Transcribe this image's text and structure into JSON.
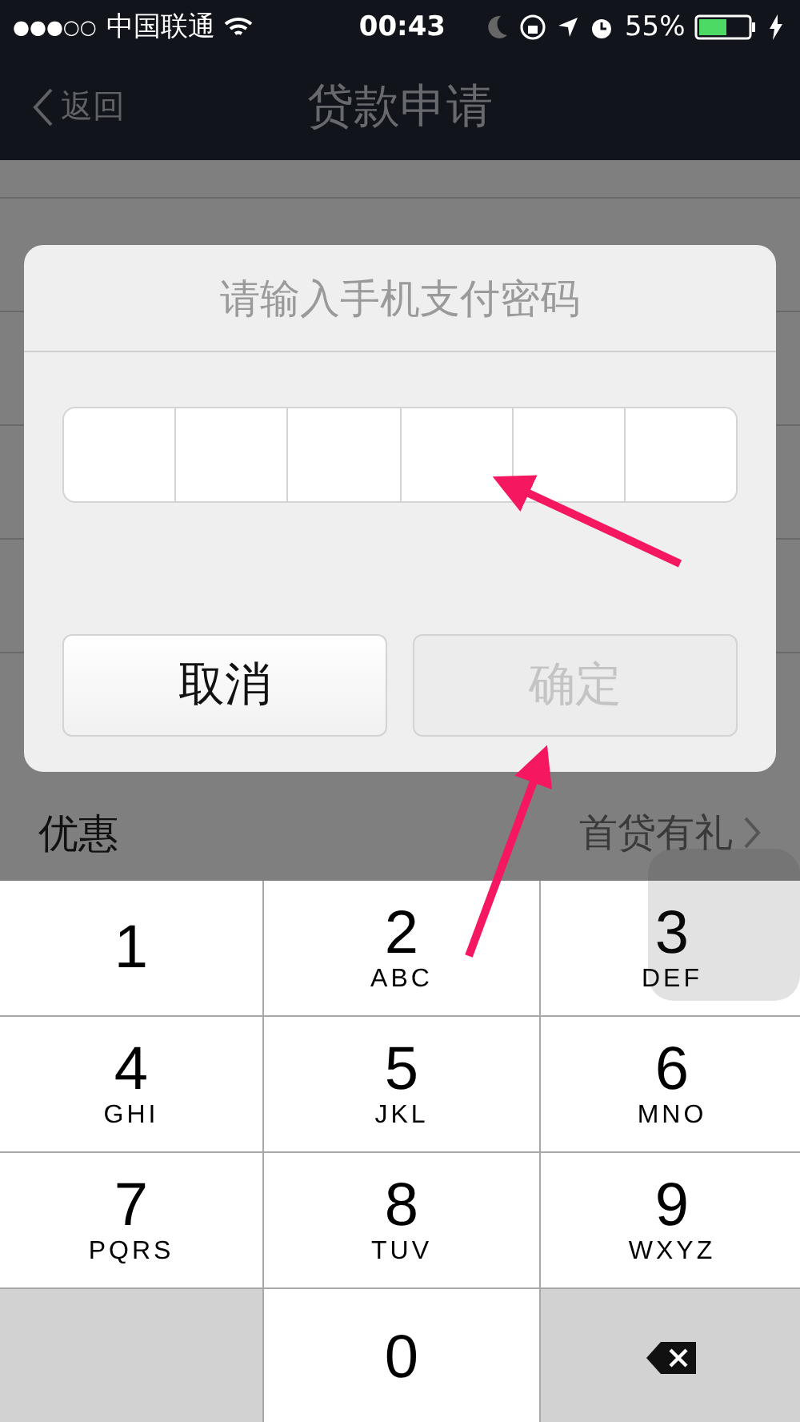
{
  "status_bar": {
    "signal_dots": "●●●○○",
    "carrier": "中国联通",
    "time": "00:43",
    "battery": "55%"
  },
  "nav": {
    "back": "返回",
    "title": "贷款申请"
  },
  "rows": [
    {
      "label": "优惠",
      "value": "首贷有礼"
    }
  ],
  "dialog": {
    "title": "请输入手机支付密码",
    "boxes": [
      {
        "filled": false
      },
      {
        "filled": false
      },
      {
        "filled": false
      },
      {
        "filled": false
      },
      {
        "filled": false
      },
      {
        "filled": false
      }
    ],
    "buttons": [
      {
        "label": "取消",
        "disabled": false
      },
      {
        "label": "确定",
        "disabled": true
      }
    ]
  },
  "keypad": [
    {
      "kind": "digit",
      "digit": "1"
    },
    {
      "kind": "digit",
      "digit": "2",
      "letters": "ABC"
    },
    {
      "kind": "digit",
      "digit": "3",
      "letters": "DEF"
    },
    {
      "kind": "digit",
      "digit": "4",
      "letters": "GHI"
    },
    {
      "kind": "digit",
      "digit": "5",
      "letters": "JKL"
    },
    {
      "kind": "digit",
      "digit": "6",
      "letters": "MNO"
    },
    {
      "kind": "digit",
      "digit": "7",
      "letters": "PQRS"
    },
    {
      "kind": "digit",
      "digit": "8",
      "letters": "TUV"
    },
    {
      "kind": "digit",
      "digit": "9",
      "letters": "WXYZ"
    },
    {
      "kind": "blank"
    },
    {
      "kind": "digit",
      "digit": "0"
    },
    {
      "kind": "delete"
    }
  ]
}
